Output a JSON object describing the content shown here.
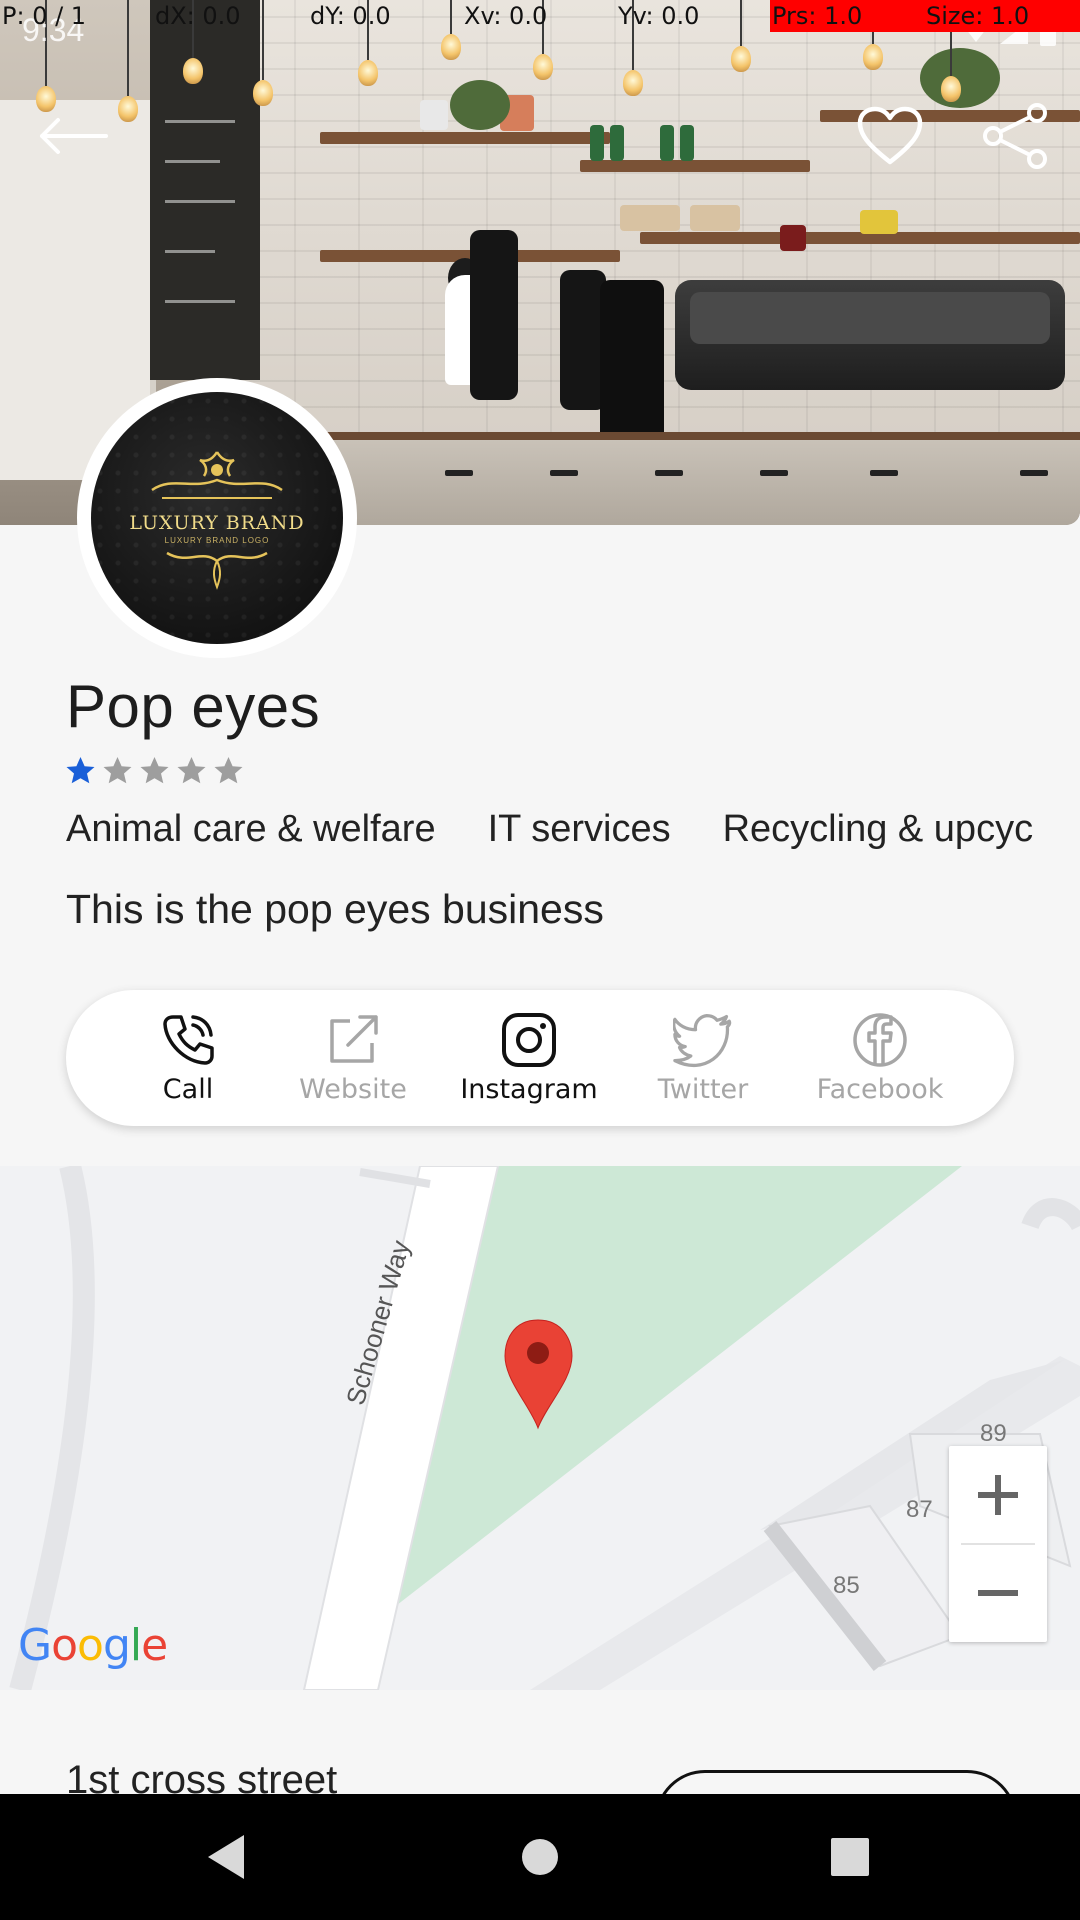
{
  "debug_overlay": {
    "p": "P: 0 / 1",
    "dx": "dX: 0.0",
    "dy": "dY: 0.0",
    "xv": "Xv: 0.0",
    "yv": "Yv: 0.0",
    "prs": "Prs: 1.0",
    "size": "Size: 1.0"
  },
  "status_bar": {
    "time": "9:34"
  },
  "hero": {
    "back_icon": "arrow-left-icon",
    "favorite_icon": "heart-outline-icon",
    "share_icon": "share-icon"
  },
  "avatar": {
    "brand_name": "LUXURY BRAND",
    "brand_sub": "LUXURY BRAND LOGO"
  },
  "business": {
    "name": "Pop eyes",
    "rating": 1,
    "rating_max": 5,
    "categories": [
      "Animal care & welfare",
      "IT services",
      "Recycling & upcyc"
    ],
    "description": "This is the pop eyes business"
  },
  "actions": [
    {
      "label": "Call",
      "icon": "phone-icon",
      "enabled": true
    },
    {
      "label": "Website",
      "icon": "external-link-icon",
      "enabled": false
    },
    {
      "label": "Instagram",
      "icon": "instagram-icon",
      "enabled": true
    },
    {
      "label": "Twitter",
      "icon": "twitter-icon",
      "enabled": false
    },
    {
      "label": "Facebook",
      "icon": "facebook-icon",
      "enabled": false
    }
  ],
  "map": {
    "street": "Schooner Way",
    "house_numbers": [
      "89",
      "87",
      "85"
    ],
    "zoom_in": "+",
    "zoom_out": "−",
    "attribution": "Google"
  },
  "address": {
    "line1": "1st cross street"
  },
  "colors": {
    "accent": "#1a5fd8",
    "star_empty": "#9e9e9e",
    "disabled_text": "#a6a6a6",
    "map_park": "#cde8d6",
    "pin_red": "#e94235"
  }
}
